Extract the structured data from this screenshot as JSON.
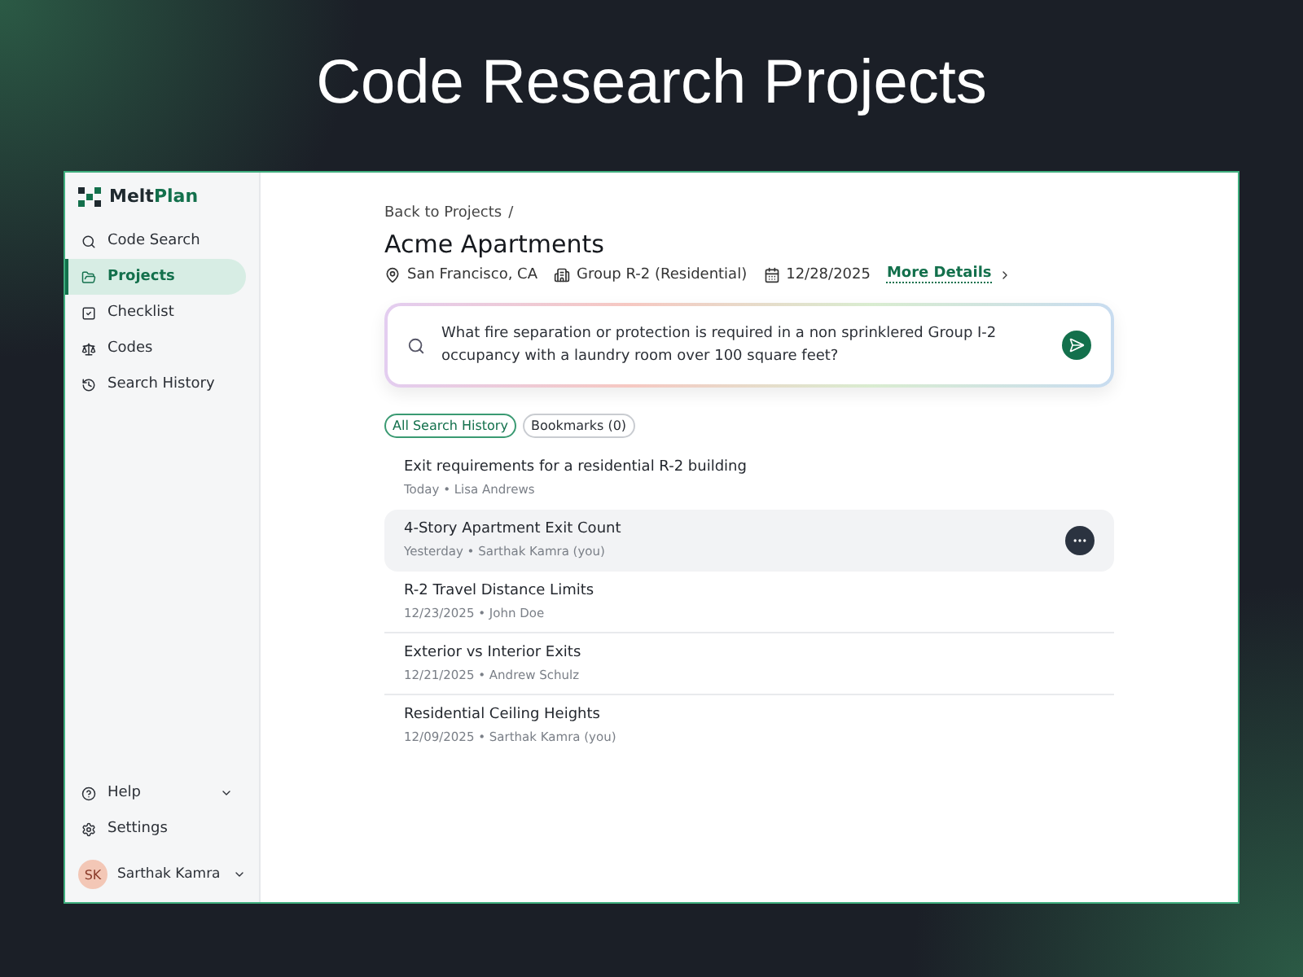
{
  "headline": "Code Research Projects",
  "logo": {
    "first": "Melt",
    "second": "Plan"
  },
  "sidebar": {
    "items": [
      {
        "kind": "search",
        "label": "Code Search",
        "selected": false
      },
      {
        "kind": "folder",
        "label": "Projects",
        "selected": true
      },
      {
        "kind": "checklist",
        "label": "Checklist",
        "selected": false
      },
      {
        "kind": "codes",
        "label": "Codes",
        "selected": false
      },
      {
        "kind": "history",
        "label": "Search History",
        "selected": false
      }
    ],
    "bottom": [
      {
        "kind": "help",
        "label": "Help",
        "expandable": true
      },
      {
        "kind": "settings",
        "label": "Settings",
        "expandable": false
      }
    ],
    "user": {
      "initials": "SK",
      "name": "Sarthak Kamra"
    }
  },
  "breadcrumb": {
    "link": "Back to Projects",
    "separator": "/"
  },
  "project": {
    "title": "Acme Apartments",
    "location": "San Francisco, CA",
    "group": "Group R-2 (Residential)",
    "date": "12/28/2025",
    "details_link": "More Details"
  },
  "search": {
    "value": "What fire separation or protection is required in a non sprinklered Group I-2 occupancy with a laundry room over 100 square feet?"
  },
  "tabs": [
    {
      "label": "All Search History",
      "selected": true
    },
    {
      "label": "Bookmarks (0)",
      "selected": false
    }
  ],
  "history": [
    {
      "title": "Exit requirements for a residential R-2 building",
      "meta": "Today • Lisa Andrews",
      "highlighted": false,
      "divider_below": false
    },
    {
      "title": "4-Story Apartment Exit Count",
      "meta": "Yesterday • Sarthak Kamra (you)",
      "highlighted": true,
      "divider_below": false
    },
    {
      "title": "R-2 Travel Distance Limits",
      "meta": "12/23/2025 • John Doe",
      "highlighted": false,
      "divider_below": true
    },
    {
      "title": "Exterior vs Interior Exits",
      "meta": "12/21/2025 • Andrew Schulz",
      "highlighted": false,
      "divider_below": true
    },
    {
      "title": "Residential Ceiling Heights",
      "meta": "12/09/2025 • Sarthak Kamra (you)",
      "highlighted": false,
      "divider_below": false
    }
  ]
}
